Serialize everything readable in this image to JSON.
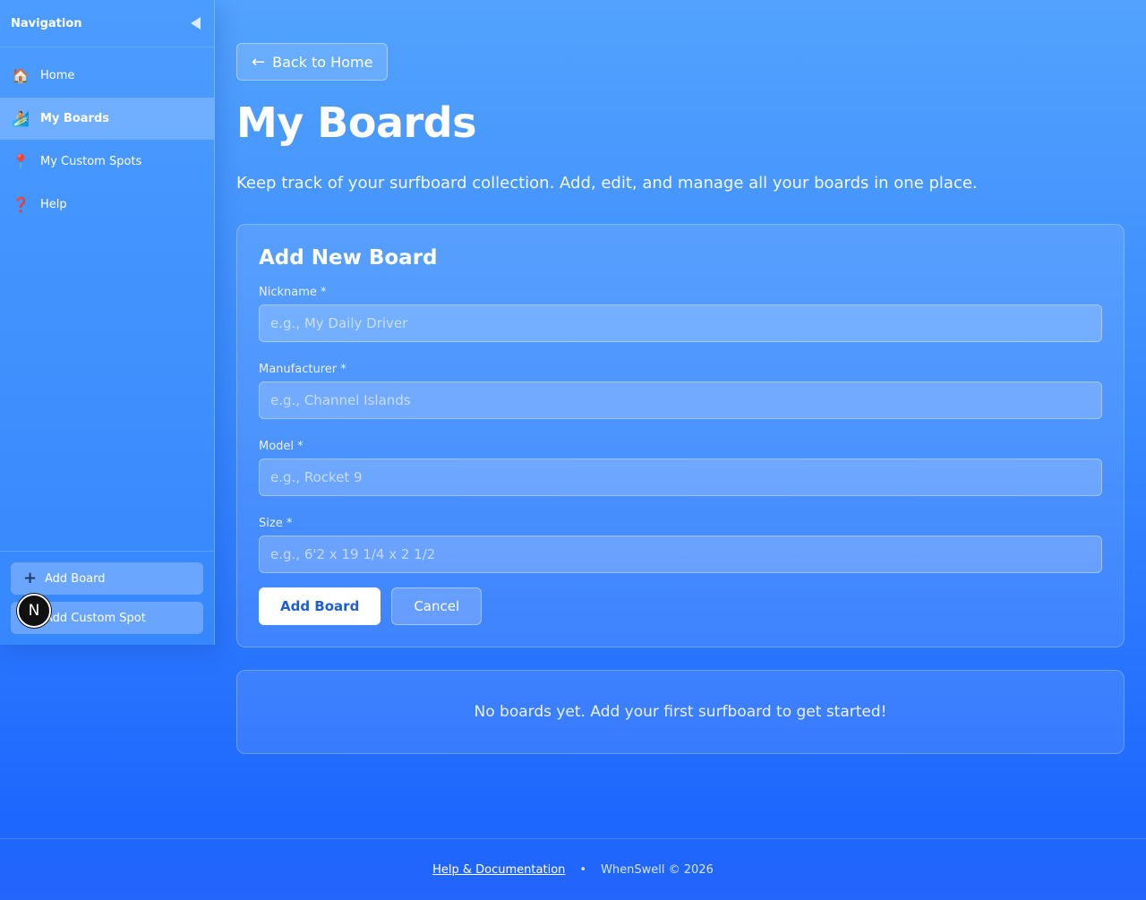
{
  "sidebar": {
    "title": "Navigation",
    "collapse_icon": "triangle-left-icon",
    "items": [
      {
        "icon": "🏠",
        "icon_name": "house-icon",
        "label": "Home",
        "active": false
      },
      {
        "icon": "🏄",
        "icon_name": "surfer-icon",
        "label": "My Boards",
        "active": true
      },
      {
        "icon": "📍",
        "icon_name": "pin-icon",
        "label": "My Custom Spots",
        "active": false
      },
      {
        "icon": "❓",
        "icon_name": "question-icon",
        "label": "Help",
        "active": false
      }
    ],
    "add_board_label": "Add Board",
    "add_board_icon": "+",
    "add_spot_label": "Add Custom Spot",
    "badge_letter": "N"
  },
  "main": {
    "back_arrow": "←",
    "back_label": "Back to Home",
    "title": "My Boards",
    "subtitle": "Keep track of your surfboard collection. Add, edit, and manage all your boards in one place."
  },
  "form": {
    "title": "Add New Board",
    "fields": [
      {
        "label": "Nickname *",
        "placeholder": "e.g., My Daily Driver",
        "value": ""
      },
      {
        "label": "Manufacturer *",
        "placeholder": "e.g., Channel Islands",
        "value": ""
      },
      {
        "label": "Model *",
        "placeholder": "e.g., Rocket 9",
        "value": ""
      },
      {
        "label": "Size *",
        "placeholder": "e.g., 6'2 x 19 1/4 x 2 1/2",
        "value": ""
      }
    ],
    "submit_label": "Add Board",
    "cancel_label": "Cancel"
  },
  "empty_state": {
    "message": "No boards yet. Add your first surfboard to get started!"
  },
  "footer": {
    "help_link": "Help & Documentation",
    "separator": "•",
    "copyright": "WhenSwell © 2026"
  },
  "colors": {
    "bg_top": "#52a2fe",
    "bg_bottom": "#1d66fe",
    "primary_button_text": "#1d5ed8"
  }
}
